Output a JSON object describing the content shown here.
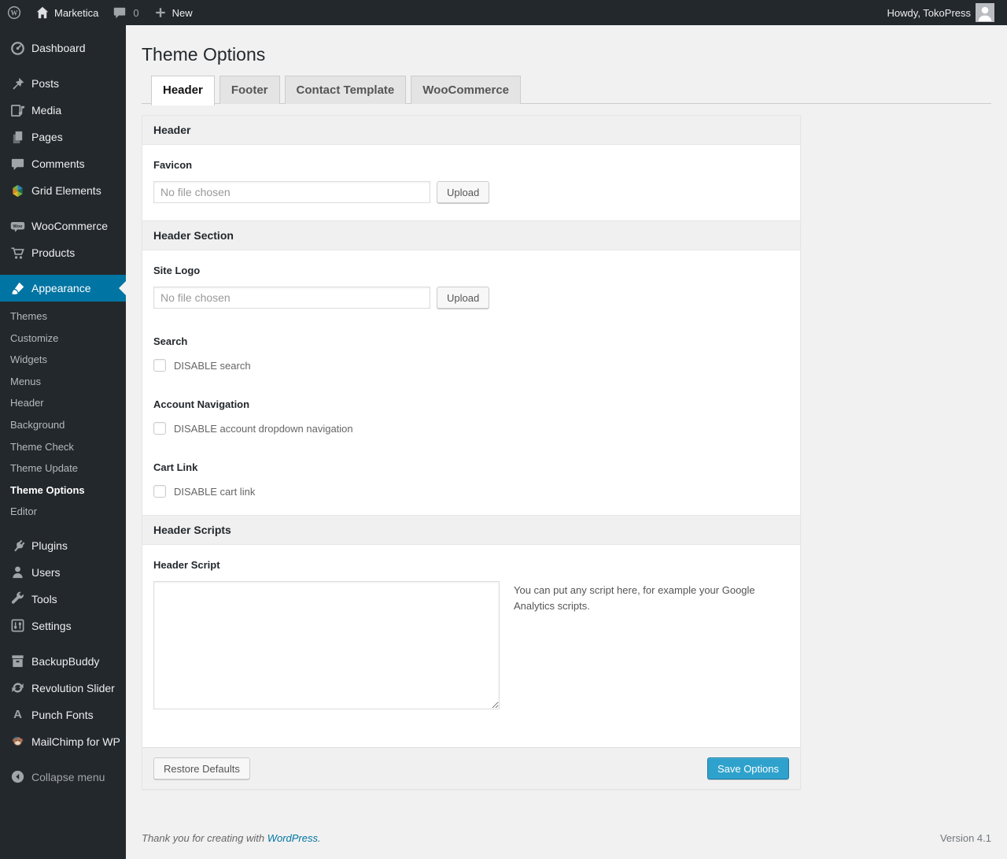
{
  "admin_bar": {
    "logo_letter": "W",
    "wordpress_logo_icon": "wordpress-logo-icon",
    "site_menu": {
      "icon": "home-icon",
      "label": "Marketica"
    },
    "comments_menu": {
      "icon": "comment-bubble-icon",
      "count": "0"
    },
    "new_menu": {
      "icon": "plus-icon",
      "label": "New"
    },
    "howdy": "Howdy, TokoPress",
    "avatar_icon": "user-avatar-image"
  },
  "sidebar": {
    "items": [
      {
        "label": "Dashboard",
        "icon": "dashboard-gauge-icon"
      },
      {
        "label": "Posts",
        "icon": "pushpin-icon"
      },
      {
        "label": "Media",
        "icon": "media-note-icon"
      },
      {
        "label": "Pages",
        "icon": "pages-icon"
      },
      {
        "label": "Comments",
        "icon": "comment-bubble-icon"
      },
      {
        "label": "Grid Elements",
        "icon": "grid-pinwheel-icon"
      },
      {
        "label": "WooCommerce",
        "icon": "woocommerce-badge-icon",
        "badge": "Woo"
      },
      {
        "label": "Products",
        "icon": "shopping-cart-icon"
      },
      {
        "label": "Appearance",
        "icon": "appearance-brush-icon",
        "active": true
      },
      {
        "label": "Plugins",
        "icon": "plugin-icon"
      },
      {
        "label": "Users",
        "icon": "user-silhouette-icon"
      },
      {
        "label": "Tools",
        "icon": "wrench-icon"
      },
      {
        "label": "Settings",
        "icon": "settings-sliders-icon"
      },
      {
        "label": "BackupBuddy",
        "icon": "backup-archive-icon"
      },
      {
        "label": "Revolution Slider",
        "icon": "refresh-arrows-icon"
      },
      {
        "label": "Punch Fonts",
        "icon": "letter-a-icon",
        "glyph": "A"
      },
      {
        "label": "MailChimp for WP",
        "icon": "mailchimp-monkey-icon"
      },
      {
        "label": "Collapse menu",
        "icon": "collapse-arrow-icon"
      }
    ],
    "appearance_submenu": {
      "items": [
        "Themes",
        "Customize",
        "Widgets",
        "Menus",
        "Header",
        "Background",
        "Theme Check",
        "Theme Update",
        "Theme Options",
        "Editor"
      ],
      "active_item": "Theme Options"
    }
  },
  "main": {
    "title": "Theme Options",
    "tabs": [
      {
        "label": "Header",
        "active": true
      },
      {
        "label": "Footer",
        "active": false
      },
      {
        "label": "Contact Template",
        "active": false
      },
      {
        "label": "WooCommerce",
        "active": false
      }
    ],
    "panel": {
      "header_section_title": "Header",
      "favicon": {
        "label": "Favicon",
        "placeholder": "No file chosen",
        "button": "Upload"
      },
      "header_section2_title": "Header Section",
      "site_logo": {
        "label": "Site Logo",
        "placeholder": "No file chosen",
        "button": "Upload"
      },
      "search": {
        "label": "Search",
        "checkbox": "DISABLE search",
        "checked": false
      },
      "account_navigation": {
        "label": "Account Navigation",
        "checkbox": "DISABLE account dropdown navigation",
        "checked": false
      },
      "cart_link": {
        "label": "Cart Link",
        "checkbox": "DISABLE cart link",
        "checked": false
      },
      "scripts_section_title": "Header Scripts",
      "header_script": {
        "label": "Header Script",
        "value": "",
        "description": "You can put any script here, for example your Google Analytics scripts."
      },
      "footer": {
        "restore_button": "Restore Defaults",
        "save_button": "Save Options"
      }
    },
    "page_footer": {
      "thanks": "Thank you for creating with",
      "link": "WordPress",
      "suffix": ".",
      "version": "Version 4.1"
    }
  },
  "colors": {
    "accent": "#0074a2",
    "primary_button": "#2ea2cc",
    "sidebar_bg": "#23282d",
    "page_bg": "#f1f1f1",
    "link": "#0074a2"
  }
}
